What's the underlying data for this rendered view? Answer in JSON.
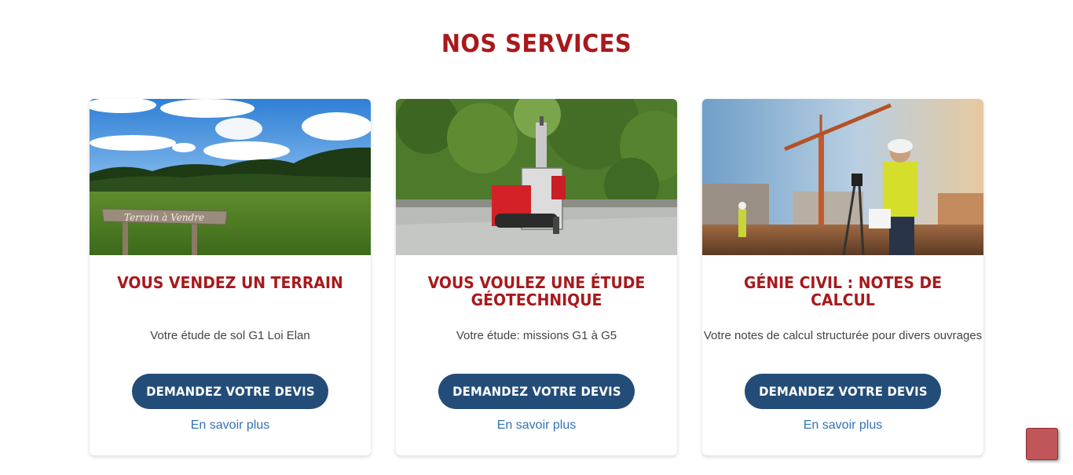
{
  "section": {
    "title": "NOS SERVICES"
  },
  "cards": [
    {
      "title": "VOUS VENDEZ UN TERRAIN",
      "description": "Votre étude de sol G1 Loi Elan",
      "button_label": "DEMANDEZ VOTRE DEVIS",
      "link_label": "En savoir plus",
      "image": {
        "sign_text": "Terrain à Vendre"
      }
    },
    {
      "title_line1": "VOUS VOULEZ UNE ÉTUDE",
      "title_line2": "GÉOTECHNIQUE",
      "description": "Votre étude: missions G1 à G5",
      "button_label": "DEMANDEZ VOTRE DEVIS",
      "link_label": "En savoir plus"
    },
    {
      "title": "GÉNIE CIVIL : NOTES DE CALCUL",
      "description": "Votre notes de calcul structurée pour divers ouvrages",
      "button_label": "DEMANDEZ VOTRE DEVIS",
      "link_label": "En savoir plus"
    }
  ],
  "colors": {
    "title_red": "#a8191c",
    "button_blue": "#234d78",
    "link_blue": "#3273b0",
    "scroll_button": "#c0565a"
  },
  "scroll_top_icon": "scroll-to-top-square"
}
